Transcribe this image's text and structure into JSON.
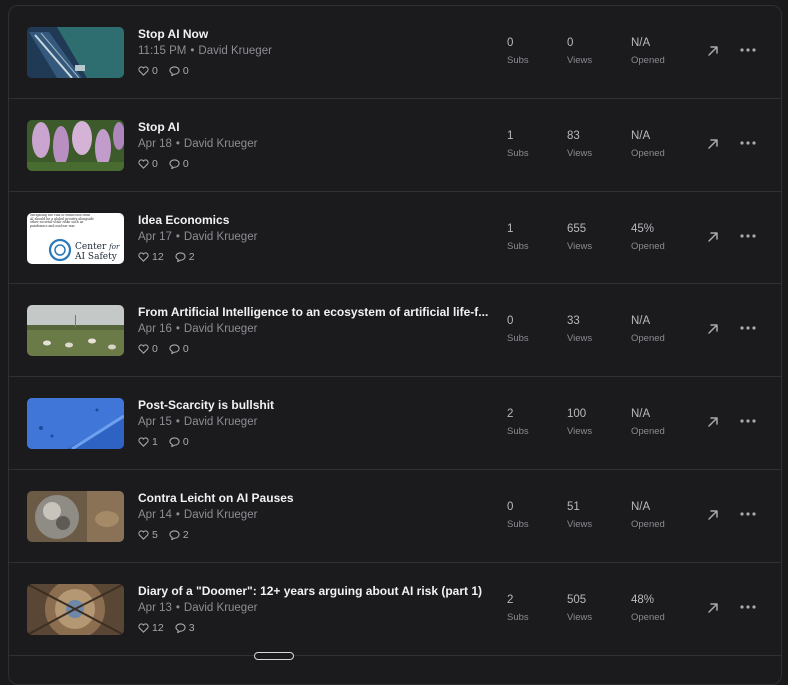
{
  "posts": [
    {
      "title": "Stop AI Now",
      "date": "11:15 PM",
      "sep": "•",
      "author": "David Krueger",
      "likes": "0",
      "comments": "0",
      "subs": "0",
      "views": "0",
      "opened": "N/A",
      "thumb": "underwater-ship"
    },
    {
      "title": "Stop AI",
      "date": "Apr 18",
      "sep": "•",
      "author": "David Krueger",
      "likes": "0",
      "comments": "0",
      "subs": "1",
      "views": "83",
      "opened": "N/A",
      "thumb": "purple-flowers"
    },
    {
      "title": "Idea Economics",
      "date": "Apr 17",
      "sep": "•",
      "author": "David Krueger",
      "likes": "12",
      "comments": "2",
      "subs": "1",
      "views": "655",
      "opened": "45%",
      "thumb": "cais-statement",
      "thumb_text": {
        "statement": "Mitigating the risk of extinction from AI should be a global priority alongside other societal-scale risks such as pandemics and nuclear war.",
        "logo_line1": "Center",
        "logo_for": "for",
        "logo_line2": "AI Safety"
      }
    },
    {
      "title": "From Artificial Intelligence to an ecosystem of artificial life-f...",
      "date": "Apr 16",
      "sep": "•",
      "author": "David Krueger",
      "likes": "0",
      "comments": "0",
      "subs": "0",
      "views": "33",
      "opened": "N/A",
      "thumb": "pasture-sheep"
    },
    {
      "title": "Post-Scarcity is bullshit",
      "date": "Apr 15",
      "sep": "•",
      "author": "David Krueger",
      "likes": "1",
      "comments": "0",
      "subs": "2",
      "views": "100",
      "opened": "N/A",
      "thumb": "blue-water"
    },
    {
      "title": "Contra Leicht on AI Pauses",
      "date": "Apr 14",
      "sep": "•",
      "author": "David Krueger",
      "likes": "5",
      "comments": "2",
      "subs": "0",
      "views": "51",
      "opened": "N/A",
      "thumb": "metal-sphere"
    },
    {
      "title": "Diary of a \"Doomer\": 12+ years arguing about AI risk (part 1)",
      "date": "Apr 13",
      "sep": "•",
      "author": "David Krueger",
      "likes": "12",
      "comments": "3",
      "subs": "2",
      "views": "505",
      "opened": "48%",
      "thumb": "cathedral-ceiling"
    }
  ],
  "labels": {
    "subs": "Subs",
    "views": "Views",
    "opened": "Opened"
  },
  "icons": {
    "like": "heart-icon",
    "comment": "comment-icon",
    "open": "external-link-icon",
    "more": "more-icon"
  },
  "colors": {
    "background": "#1b1b1e",
    "divider": "#303034",
    "title": "#f2f2f4",
    "meta": "#8d8d93"
  }
}
